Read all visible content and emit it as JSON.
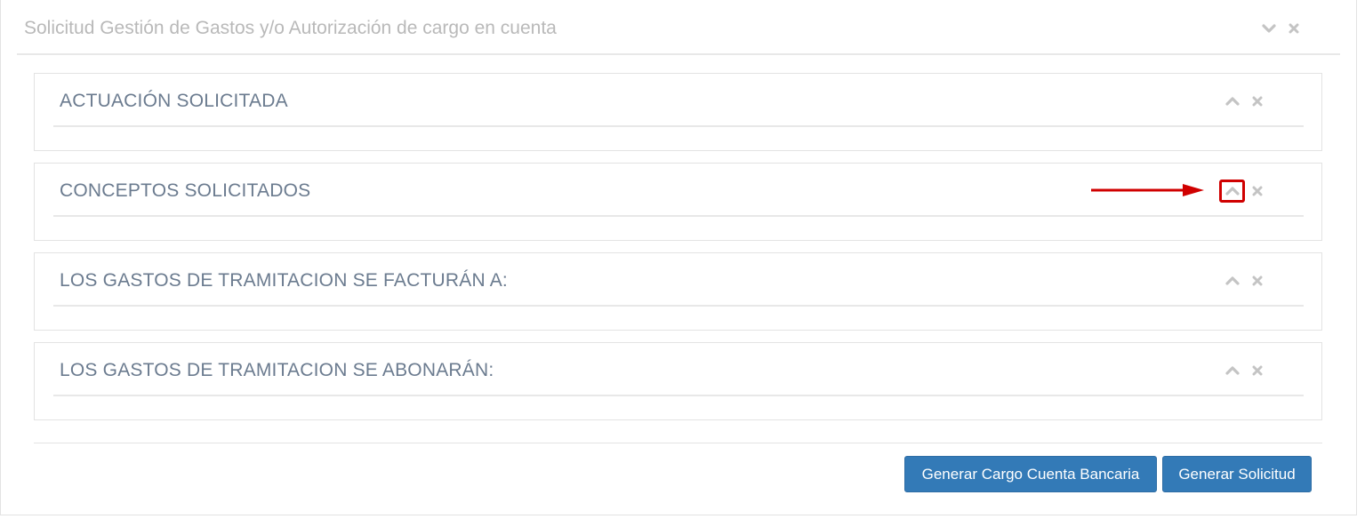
{
  "panel": {
    "title": "Solicitud Gestión de Gastos y/o Autorización de cargo en cuenta",
    "collapse_icon": "chevron-down-icon",
    "close_icon": "close-icon"
  },
  "sections": [
    {
      "title": "ACTUACIÓN SOLICITADA",
      "toggle_icon": "chevron-up-icon",
      "close_icon": "close-icon"
    },
    {
      "title": "CONCEPTOS SOLICITADOS",
      "toggle_icon": "chevron-up-icon",
      "close_icon": "close-icon"
    },
    {
      "title": "LOS GASTOS DE TRAMITACION SE FACTURÁN A:",
      "toggle_icon": "chevron-up-icon",
      "close_icon": "close-icon"
    },
    {
      "title": "LOS GASTOS DE TRAMITACION SE ABONARÁN:",
      "toggle_icon": "chevron-up-icon",
      "close_icon": "close-icon"
    }
  ],
  "footer": {
    "cargo_button_label": "Generar Cargo Cuenta Bancaria",
    "solicitud_button_label": "Generar Solicitud"
  },
  "colors": {
    "primary_button": "#337ab7",
    "title_text": "#6b7b8f",
    "muted_text": "#b9b9b9",
    "annotation": "#d00000"
  }
}
